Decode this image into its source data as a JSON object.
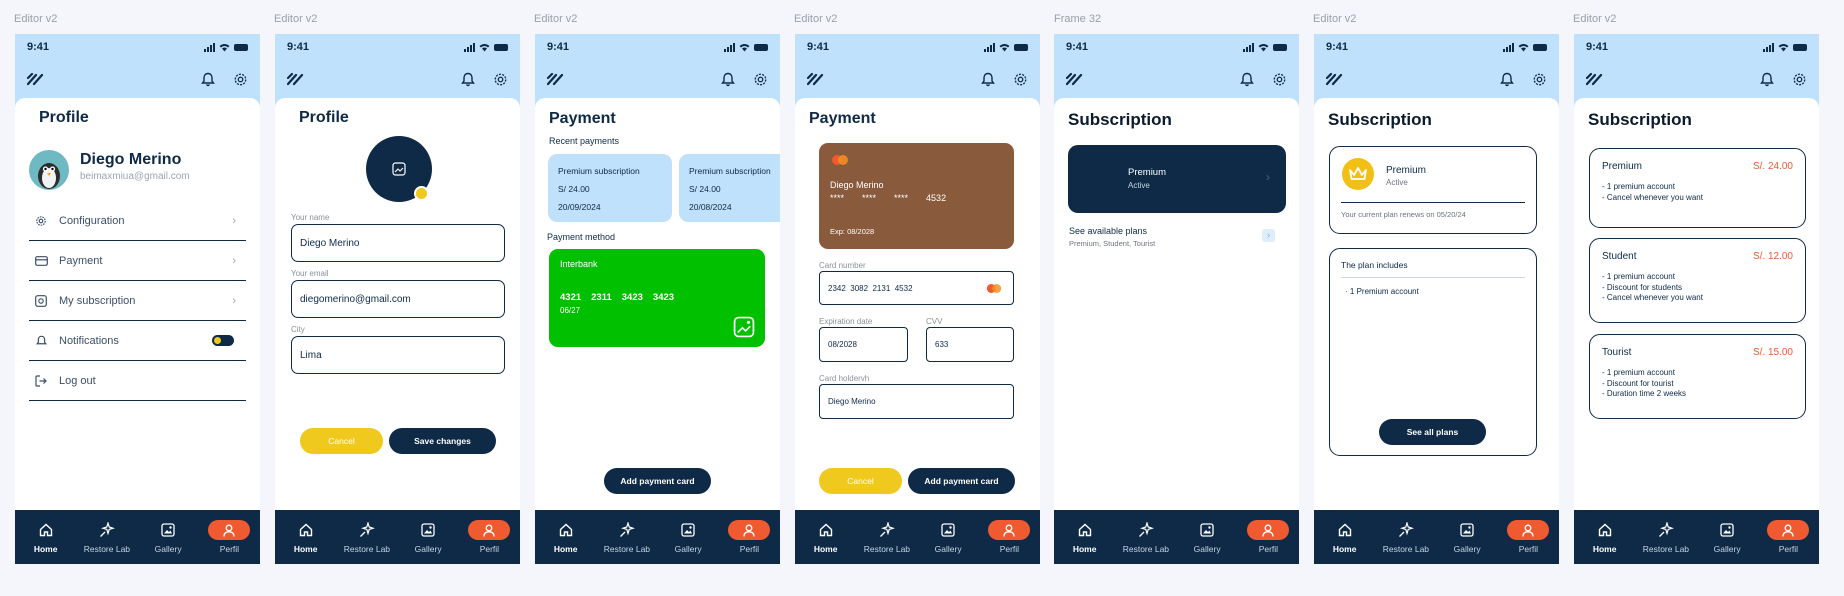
{
  "frames": [
    "Editor v2",
    "Editor v2",
    "Editor v2",
    "Editor v2",
    "Frame 32",
    "Editor v2",
    "Editor v2"
  ],
  "status": {
    "time": "9:41"
  },
  "nav": {
    "home": "Home",
    "restore": "Restore Lab",
    "gallery": "Gallery",
    "perfil": "Perfil"
  },
  "s1": {
    "title": "Profile",
    "name": "Diego Merino",
    "email": "beimaxmiua@gmail.com",
    "menu": [
      {
        "label": "Configuration",
        "icon": "gear-icon"
      },
      {
        "label": "Payment",
        "icon": "card-icon"
      },
      {
        "label": "My subscription",
        "icon": "subscription-icon"
      },
      {
        "label": "Notifications",
        "icon": "bell-icon"
      },
      {
        "label": "Log out",
        "icon": "logout-icon"
      }
    ],
    "notifications_on": true
  },
  "s2": {
    "title": "Profile",
    "name_label": "Your name",
    "name_value": "Diego Merino",
    "email_label": "Your email",
    "email_value": "diegomerino@gmail.com",
    "city_label": "City",
    "city_value": "Lima",
    "cancel": "Cancel",
    "save": "Save changes"
  },
  "s3": {
    "title": "Payment",
    "recent_label": "Recent payments",
    "payments": [
      {
        "name": "Premium subscription",
        "amount": "S/ 24.00",
        "date": "20/09/2024"
      },
      {
        "name": "Premium subscription",
        "amount": "S/ 24.00",
        "date": "20/08/2024"
      }
    ],
    "method_label": "Payment method",
    "card": {
      "bank": "Interbank",
      "number": [
        "4321",
        "2311",
        "3423",
        "3423"
      ],
      "expiry": "06/27"
    },
    "add_button": "Add payment card"
  },
  "s4": {
    "title": "Payment",
    "card": {
      "holder": "Diego Merino",
      "masked": [
        "****",
        "****",
        "****",
        "4532"
      ],
      "exp": "Exp: 08/2028"
    },
    "number_label": "Card number",
    "number_value": "2342  3082  2131  4532",
    "exp_label": "Expiration date",
    "exp_value": "08/2028",
    "cvv_label": "CVV",
    "cvv_value": "633",
    "holder_label": "Card holdervh",
    "holder_value": "Diego Merino",
    "cancel": "Cancel",
    "add": "Add payment card"
  },
  "s5": {
    "title": "Subscription",
    "plan": "Premium",
    "status": "Active",
    "see_plans": "See available plans",
    "plans_sub": "Premium, Student, Tourist"
  },
  "s6": {
    "title": "Subscription",
    "plan": "Premium",
    "status": "Active",
    "renew": "Your current plan renews on 05/20/24",
    "includes_title": "The plan includes",
    "includes": [
      "1 Premium account"
    ],
    "button": "See all plans"
  },
  "s7": {
    "title": "Subscription",
    "plans": [
      {
        "name": "Premium",
        "price": "S/. 24.00",
        "features": [
          "1 premium account",
          "Cancel whenever you want"
        ]
      },
      {
        "name": "Student",
        "price": "S/. 12.00",
        "features": [
          "1 premium account",
          "Discount for students",
          "Cancel whenever you want"
        ]
      },
      {
        "name": "Tourist",
        "price": "S/. 15.00",
        "features": [
          "1 premium account",
          "Discount for tourist",
          "Duration time 2 weeks"
        ]
      }
    ]
  },
  "colors": {
    "navy": "#0e2a47",
    "sky": "#bfe1fb",
    "orange": "#ef5a31",
    "yellow": "#efc91d",
    "green": "#00c000",
    "brown": "#8a5a3c"
  }
}
